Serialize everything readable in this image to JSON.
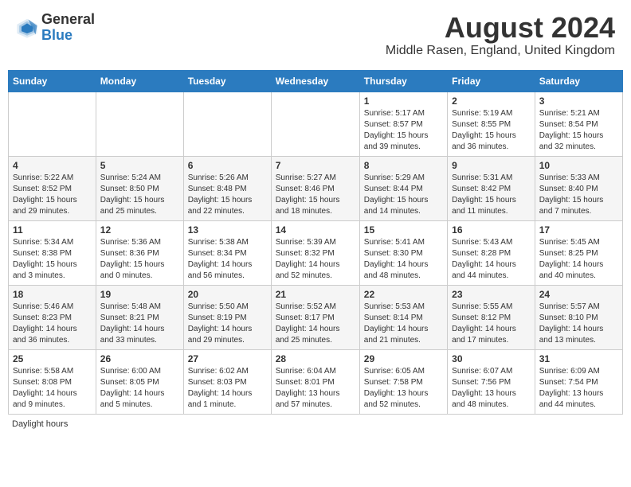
{
  "header": {
    "logo_general": "General",
    "logo_blue": "Blue",
    "title": "August 2024",
    "subtitle": "Middle Rasen, England, United Kingdom"
  },
  "calendar": {
    "days_of_week": [
      "Sunday",
      "Monday",
      "Tuesday",
      "Wednesday",
      "Thursday",
      "Friday",
      "Saturday"
    ],
    "weeks": [
      [
        {
          "day": "",
          "info": ""
        },
        {
          "day": "",
          "info": ""
        },
        {
          "day": "",
          "info": ""
        },
        {
          "day": "",
          "info": ""
        },
        {
          "day": "1",
          "info": "Sunrise: 5:17 AM\nSunset: 8:57 PM\nDaylight: 15 hours and 39 minutes."
        },
        {
          "day": "2",
          "info": "Sunrise: 5:19 AM\nSunset: 8:55 PM\nDaylight: 15 hours and 36 minutes."
        },
        {
          "day": "3",
          "info": "Sunrise: 5:21 AM\nSunset: 8:54 PM\nDaylight: 15 hours and 32 minutes."
        }
      ],
      [
        {
          "day": "4",
          "info": "Sunrise: 5:22 AM\nSunset: 8:52 PM\nDaylight: 15 hours and 29 minutes."
        },
        {
          "day": "5",
          "info": "Sunrise: 5:24 AM\nSunset: 8:50 PM\nDaylight: 15 hours and 25 minutes."
        },
        {
          "day": "6",
          "info": "Sunrise: 5:26 AM\nSunset: 8:48 PM\nDaylight: 15 hours and 22 minutes."
        },
        {
          "day": "7",
          "info": "Sunrise: 5:27 AM\nSunset: 8:46 PM\nDaylight: 15 hours and 18 minutes."
        },
        {
          "day": "8",
          "info": "Sunrise: 5:29 AM\nSunset: 8:44 PM\nDaylight: 15 hours and 14 minutes."
        },
        {
          "day": "9",
          "info": "Sunrise: 5:31 AM\nSunset: 8:42 PM\nDaylight: 15 hours and 11 minutes."
        },
        {
          "day": "10",
          "info": "Sunrise: 5:33 AM\nSunset: 8:40 PM\nDaylight: 15 hours and 7 minutes."
        }
      ],
      [
        {
          "day": "11",
          "info": "Sunrise: 5:34 AM\nSunset: 8:38 PM\nDaylight: 15 hours and 3 minutes."
        },
        {
          "day": "12",
          "info": "Sunrise: 5:36 AM\nSunset: 8:36 PM\nDaylight: 15 hours and 0 minutes."
        },
        {
          "day": "13",
          "info": "Sunrise: 5:38 AM\nSunset: 8:34 PM\nDaylight: 14 hours and 56 minutes."
        },
        {
          "day": "14",
          "info": "Sunrise: 5:39 AM\nSunset: 8:32 PM\nDaylight: 14 hours and 52 minutes."
        },
        {
          "day": "15",
          "info": "Sunrise: 5:41 AM\nSunset: 8:30 PM\nDaylight: 14 hours and 48 minutes."
        },
        {
          "day": "16",
          "info": "Sunrise: 5:43 AM\nSunset: 8:28 PM\nDaylight: 14 hours and 44 minutes."
        },
        {
          "day": "17",
          "info": "Sunrise: 5:45 AM\nSunset: 8:25 PM\nDaylight: 14 hours and 40 minutes."
        }
      ],
      [
        {
          "day": "18",
          "info": "Sunrise: 5:46 AM\nSunset: 8:23 PM\nDaylight: 14 hours and 36 minutes."
        },
        {
          "day": "19",
          "info": "Sunrise: 5:48 AM\nSunset: 8:21 PM\nDaylight: 14 hours and 33 minutes."
        },
        {
          "day": "20",
          "info": "Sunrise: 5:50 AM\nSunset: 8:19 PM\nDaylight: 14 hours and 29 minutes."
        },
        {
          "day": "21",
          "info": "Sunrise: 5:52 AM\nSunset: 8:17 PM\nDaylight: 14 hours and 25 minutes."
        },
        {
          "day": "22",
          "info": "Sunrise: 5:53 AM\nSunset: 8:14 PM\nDaylight: 14 hours and 21 minutes."
        },
        {
          "day": "23",
          "info": "Sunrise: 5:55 AM\nSunset: 8:12 PM\nDaylight: 14 hours and 17 minutes."
        },
        {
          "day": "24",
          "info": "Sunrise: 5:57 AM\nSunset: 8:10 PM\nDaylight: 14 hours and 13 minutes."
        }
      ],
      [
        {
          "day": "25",
          "info": "Sunrise: 5:58 AM\nSunset: 8:08 PM\nDaylight: 14 hours and 9 minutes."
        },
        {
          "day": "26",
          "info": "Sunrise: 6:00 AM\nSunset: 8:05 PM\nDaylight: 14 hours and 5 minutes."
        },
        {
          "day": "27",
          "info": "Sunrise: 6:02 AM\nSunset: 8:03 PM\nDaylight: 14 hours and 1 minute."
        },
        {
          "day": "28",
          "info": "Sunrise: 6:04 AM\nSunset: 8:01 PM\nDaylight: 13 hours and 57 minutes."
        },
        {
          "day": "29",
          "info": "Sunrise: 6:05 AM\nSunset: 7:58 PM\nDaylight: 13 hours and 52 minutes."
        },
        {
          "day": "30",
          "info": "Sunrise: 6:07 AM\nSunset: 7:56 PM\nDaylight: 13 hours and 48 minutes."
        },
        {
          "day": "31",
          "info": "Sunrise: 6:09 AM\nSunset: 7:54 PM\nDaylight: 13 hours and 44 minutes."
        }
      ]
    ]
  },
  "footer": {
    "label": "Daylight hours"
  }
}
